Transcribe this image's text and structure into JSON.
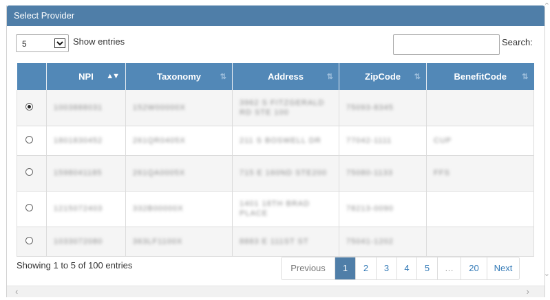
{
  "dialog": {
    "title": "Select Provider"
  },
  "length": {
    "value": "5",
    "label": "Show entries"
  },
  "search": {
    "label": "Search:",
    "value": ""
  },
  "table": {
    "columns": [
      {
        "label": "",
        "sort": ""
      },
      {
        "label": "NPI",
        "sort": "▲▼"
      },
      {
        "label": "Taxonomy",
        "sort": "⇅"
      },
      {
        "label": "Address",
        "sort": "⇅"
      },
      {
        "label": "ZipCode",
        "sort": "⇅"
      },
      {
        "label": "BenefitCode",
        "sort": "⇅"
      }
    ],
    "rows": [
      {
        "selected": true,
        "npi": "1003888031",
        "taxonomy": "152W00000X",
        "address": "3962 S FITZGERALD RD STE 100",
        "zip": "75093-8345",
        "benefit": ""
      },
      {
        "selected": false,
        "npi": "1801830452",
        "taxonomy": "261QR0405X",
        "address": "211 S BOSWELL DR",
        "zip": "77042-1111",
        "benefit": "CUP"
      },
      {
        "selected": false,
        "npi": "1598041185",
        "taxonomy": "261QA0005X",
        "address": "715 E 160ND STE200",
        "zip": "75080-1133",
        "benefit": "FFS"
      },
      {
        "selected": false,
        "npi": "1215072403",
        "taxonomy": "332B00000X",
        "address": "1401 18TH BRAD PLACE",
        "zip": "78213-0090",
        "benefit": ""
      },
      {
        "selected": false,
        "npi": "1033072080",
        "taxonomy": "363LF1100X",
        "address": "8883 E 111ST ST",
        "zip": "75041-1202",
        "benefit": ""
      }
    ]
  },
  "footer": {
    "info": "Showing 1 to 5 of 100 entries",
    "pager": [
      "Previous",
      "1",
      "2",
      "3",
      "4",
      "5",
      "…",
      "20",
      "Next"
    ],
    "active_page": "1"
  },
  "scroll": {
    "left_arrow": "‹",
    "right_arrow": "›",
    "up_arrow": "⌃",
    "down_arrow": "⌄"
  },
  "colors": {
    "header": "#4f7ea8",
    "table_header": "#5288b7",
    "link": "#337ab7"
  }
}
